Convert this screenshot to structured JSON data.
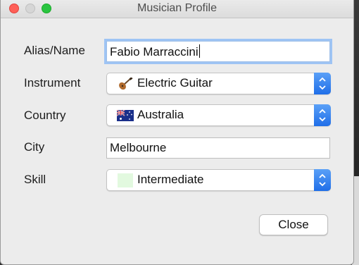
{
  "window": {
    "title": "Musician Profile"
  },
  "form": {
    "alias": {
      "label": "Alias/Name",
      "value": "Fabio Marraccini"
    },
    "instrument": {
      "label": "Instrument",
      "value": "Electric Guitar",
      "icon": "guitar-icon"
    },
    "country": {
      "label": "Country",
      "value": "Australia",
      "icon": "australia-flag-icon"
    },
    "city": {
      "label": "City",
      "value": "Melbourne"
    },
    "skill": {
      "label": "Skill",
      "value": "Intermediate",
      "swatch_color": "#e2f9df"
    }
  },
  "buttons": {
    "close_label": "Close"
  },
  "colors": {
    "accent": "#1f6ee8",
    "focus_ring": "#9ec4f4"
  }
}
